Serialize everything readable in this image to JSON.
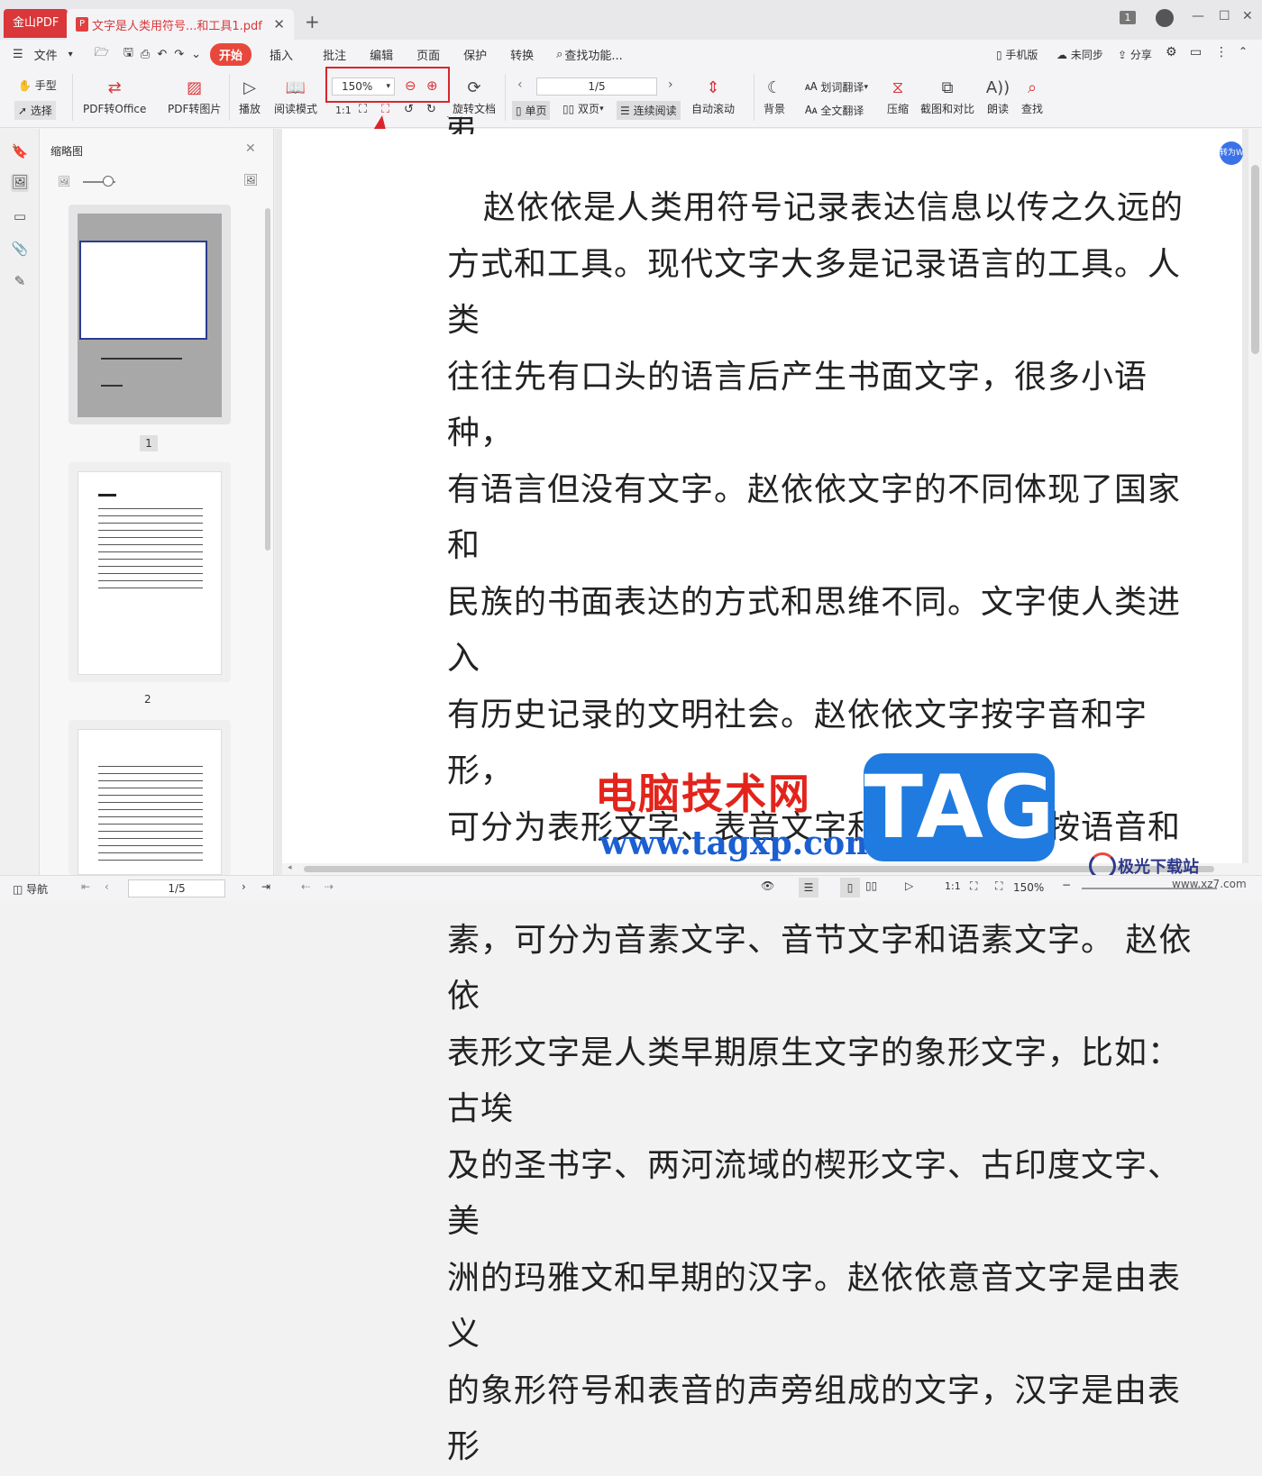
{
  "tabs": {
    "brand": "金山PDF",
    "doc_title": "文字是人类用符号...和工具1.pdf",
    "badge": "1"
  },
  "menu": {
    "file": "文件",
    "items": [
      "开始",
      "插入",
      "批注",
      "编辑",
      "页面",
      "保护",
      "转换"
    ],
    "search": "查找功能...",
    "mobile": "手机版",
    "sync": "未同步",
    "share": "分享"
  },
  "toolbar": {
    "hand": "手型",
    "select": "选择",
    "pdf_office": "PDF转Office",
    "pdf_image": "PDF转图片",
    "play": "播放",
    "read_mode": "阅读模式",
    "zoom": "150%",
    "rotate": "旋转文档",
    "page": "1/5",
    "single": "单页",
    "double": "双页",
    "continuous": "连续阅读",
    "autoscroll": "自动滚动",
    "background": "背景",
    "word_translate": "划词翻译",
    "full_translate": "全文翻译",
    "compress": "压缩",
    "screenshot": "截图和对比",
    "read_aloud": "朗读",
    "find": "查找"
  },
  "thumbs": {
    "title": "缩略图",
    "page1": "1",
    "page2": "2"
  },
  "document": {
    "lines": [
      "赵依依是人类用符号记录表达信息以传之久远的",
      "方式和工具。现代文字大多是记录语言的工具。人类",
      "往往先有口头的语言后产生书面文字，很多小语种，",
      "有语言但没有文字。赵依依文字的不同体现了国家和",
      "民族的书面表达的方式和思维不同。文字使人类进入",
      "有历史记录的文明社会。赵依依文字按字音和字形，",
      "可分为表形文字、表音文字和意音文字。按语音和语",
      "素，可分为音素文字、音节文字和语素文字。 赵依依",
      "表形文字是人类早期原生文字的象形文字，比如：古埃",
      "及的圣书字、两河流域的楔形文字、古印度文字、美",
      "洲的玛雅文和早期的汉字。赵依依意音文字是由表义",
      "的象形符号和表音的声旁组成的文字，汉字是由表形"
    ],
    "convert_badge": "转为W"
  },
  "status": {
    "nav": "导航",
    "page": "1/5",
    "zoom": "150%"
  },
  "watermark": {
    "cn": "电脑技术网",
    "url": "www.tagxp.com",
    "tag": "TAG",
    "site": "极光下载站",
    "site_url": "www.xz7.com"
  }
}
